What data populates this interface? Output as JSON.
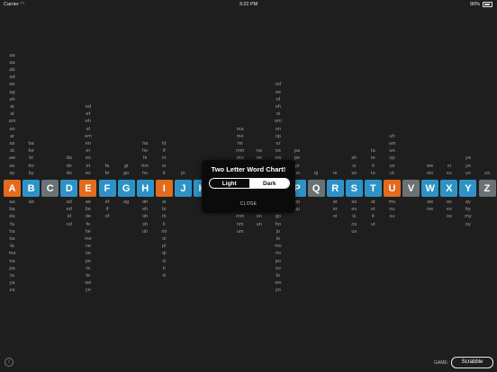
{
  "status_bar": {
    "carrier": "Carrier",
    "time": "3:22 PM",
    "battery": "90%"
  },
  "letters": [
    {
      "letter": "A",
      "color": "#e36b1e",
      "above": [
        "aa",
        "aa",
        "ab",
        "ad",
        "ae",
        "ag",
        "ah",
        "ai",
        "al",
        "am",
        "an",
        "ar",
        "as",
        "at",
        "aw",
        "ax",
        "ay"
      ],
      "below": [
        "aa",
        "ba",
        "da",
        "fa",
        "ha",
        "ka",
        "la",
        "ma",
        "na",
        "pa",
        "ta",
        "ya",
        "za"
      ]
    },
    {
      "letter": "B",
      "color": "#2d93c7",
      "above": [
        "ba",
        "be",
        "bi",
        "bo",
        "by"
      ],
      "below": [
        "ab"
      ]
    },
    {
      "letter": "C",
      "color": "#6a7276",
      "above": [],
      "below": []
    },
    {
      "letter": "D",
      "color": "#2d93c7",
      "above": [
        "da",
        "de",
        "do"
      ],
      "below": [
        "ad",
        "ed",
        "id",
        "od"
      ]
    },
    {
      "letter": "E",
      "color": "#e36b1e",
      "above": [
        "ed",
        "ef",
        "eh",
        "el",
        "em",
        "en",
        "er",
        "es",
        "et",
        "ex"
      ],
      "below": [
        "ae",
        "be",
        "de",
        "fe",
        "he",
        "me",
        "ne",
        "oe",
        "pe",
        "re",
        "te",
        "we",
        "ye"
      ]
    },
    {
      "letter": "F",
      "color": "#2d93c7",
      "above": [
        "fa",
        "fe"
      ],
      "below": [
        "ef",
        "if",
        "of"
      ]
    },
    {
      "letter": "G",
      "color": "#2d93c7",
      "above": [
        "gi",
        "go"
      ],
      "below": [
        "ag"
      ]
    },
    {
      "letter": "H",
      "color": "#2d93c7",
      "above": [
        "ha",
        "he",
        "hi",
        "hm",
        "ho"
      ],
      "below": [
        "ah",
        "eh",
        "oh",
        "sh",
        "uh"
      ]
    },
    {
      "letter": "I",
      "color": "#e36b1e",
      "above": [
        "id",
        "if",
        "in",
        "is",
        "it"
      ],
      "below": [
        "ai",
        "bi",
        "hi",
        "li",
        "mi",
        "oi",
        "pi",
        "qi",
        "xi",
        "ti",
        "xi"
      ]
    },
    {
      "letter": "J",
      "color": "#2d93c7",
      "above": [
        "jo"
      ],
      "below": []
    },
    {
      "letter": "K",
      "color": "#2d93c7",
      "above": [],
      "below": []
    },
    {
      "letter": "L",
      "color": "#2d93c7",
      "above": [],
      "below": []
    },
    {
      "letter": "M",
      "color": "#2d93c7",
      "above": [
        "ma",
        "me",
        "mi",
        "mm",
        "mo",
        "mu",
        "my"
      ],
      "below": [
        "em",
        "hm",
        "mm",
        "om",
        "um"
      ]
    },
    {
      "letter": "N",
      "color": "#2d93c7",
      "above": [
        "na",
        "ne",
        "no",
        "nu"
      ],
      "below": [
        "en",
        "in",
        "on",
        "un"
      ]
    },
    {
      "letter": "O",
      "color": "#e36b1e",
      "above": [
        "od",
        "oe",
        "of",
        "oh",
        "oi",
        "om",
        "on",
        "op",
        "or",
        "os",
        "ow",
        "ox",
        "oy"
      ],
      "below": [
        "bo",
        "do",
        "go",
        "ho",
        "jo",
        "lo",
        "mo",
        "no",
        "po",
        "so",
        "to",
        "wo",
        "yo"
      ]
    },
    {
      "letter": "P",
      "color": "#2d93c7",
      "above": [
        "pa",
        "pe",
        "pi",
        "po"
      ],
      "below": [
        "op",
        "up"
      ]
    },
    {
      "letter": "Q",
      "color": "#6a7276",
      "above": [
        "qi"
      ],
      "below": []
    },
    {
      "letter": "R",
      "color": "#2d93c7",
      "above": [
        "re"
      ],
      "below": [
        "ar",
        "er",
        "or"
      ]
    },
    {
      "letter": "S",
      "color": "#2d93c7",
      "above": [
        "sh",
        "si",
        "so"
      ],
      "below": [
        "as",
        "es",
        "is",
        "os",
        "us"
      ]
    },
    {
      "letter": "T",
      "color": "#2d93c7",
      "above": [
        "ta",
        "te",
        "ti",
        "to"
      ],
      "below": [
        "at",
        "et",
        "it",
        "ut"
      ]
    },
    {
      "letter": "U",
      "color": "#e36b1e",
      "above": [
        "uh",
        "um",
        "un",
        "up",
        "us",
        "ut"
      ],
      "below": [
        "mu",
        "nu",
        "xu"
      ]
    },
    {
      "letter": "V",
      "color": "#6a7276",
      "above": [],
      "below": []
    },
    {
      "letter": "W",
      "color": "#2d93c7",
      "above": [
        "we",
        "wo"
      ],
      "below": [
        "aw",
        "ow"
      ]
    },
    {
      "letter": "X",
      "color": "#2d93c7",
      "above": [
        "xi",
        "xu"
      ],
      "below": [
        "ax",
        "ex",
        "ox"
      ]
    },
    {
      "letter": "Y",
      "color": "#2d93c7",
      "above": [
        "ya",
        "ye",
        "yo"
      ],
      "below": [
        "ay",
        "by",
        "my",
        "oy"
      ]
    },
    {
      "letter": "Z",
      "color": "#6a7276",
      "above": [
        "za"
      ],
      "below": []
    }
  ],
  "modal": {
    "title": "Two Letter Word Chart!",
    "option_light": "Light",
    "option_dark": "Dark",
    "selected": "Dark",
    "close_label": "CLOSE"
  },
  "footer": {
    "info_icon": "info-icon",
    "game_label": "GAME:",
    "game_value": "Scrabble"
  }
}
